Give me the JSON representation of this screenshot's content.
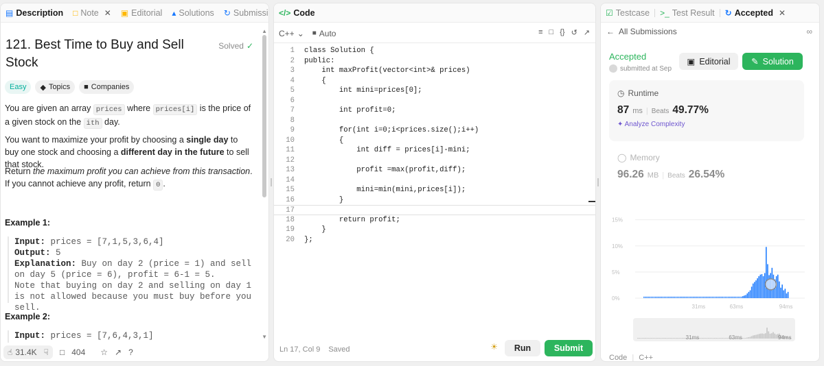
{
  "left": {
    "tabs": [
      {
        "label": "Description",
        "icon": "document-icon"
      },
      {
        "label": "Note",
        "icon": "note-icon"
      },
      {
        "label": "Editorial",
        "icon": "book-icon"
      },
      {
        "label": "Solutions",
        "icon": "flask-icon"
      },
      {
        "label": "Submissio",
        "icon": "history-icon"
      }
    ],
    "title": "121. Best Time to Buy and Sell Stock",
    "solved": "Solved",
    "difficulty": "Easy",
    "topics": "Topics",
    "companies": "Companies",
    "desc": {
      "p1a": "You are given an array ",
      "p1code1": "prices",
      "p1b": " where ",
      "p1code2": "prices[i]",
      "p1c": " is the price of a given stock on the ",
      "p1code3": "ith",
      "p1d": " day.",
      "p2a": "You want to maximize your profit by choosing a ",
      "p2b": "single day",
      "p2c": " to buy one stock and choosing a ",
      "p2d": "different day in the future",
      "p2e": " to sell that stock.",
      "p3a": "Return ",
      "p3b": "the maximum profit you can achieve from this transaction",
      "p3c": ". If you cannot achieve any profit, return ",
      "p3code": "0",
      "p3d": "."
    },
    "example1": {
      "heading": "Example 1:",
      "input_label": "Input:",
      "input": " prices = [7,1,5,3,6,4]",
      "output_label": "Output:",
      "output": " 5",
      "expl_label": "Explanation:",
      "expl": " Buy on day 2 (price = 1) and sell on day 5 (price = 6), profit = 6-1 = 5.\nNote that buying on day 2 and selling on day 1 is not allowed because you must buy before you sell."
    },
    "example2": {
      "heading": "Example 2:",
      "input_label": "Input:",
      "input": " prices = [7,6,4,3,1]"
    },
    "footer": {
      "likes": "31.4K",
      "comments": "404"
    }
  },
  "mid": {
    "tab": "Code",
    "language": "C++",
    "mode": "Auto",
    "code_lines": [
      "class Solution {",
      "public:",
      "    int maxProfit(vector<int>& prices)",
      "    {",
      "        int mini=prices[0];",
      "",
      "        int profit=0;",
      "",
      "        for(int i=0;i<prices.size();i++)",
      "        {",
      "            int diff = prices[i]-mini;",
      "",
      "            profit =max(profit,diff);",
      "",
      "            mini=min(mini,prices[i]);",
      "        }",
      "",
      "        return profit;",
      "    }",
      "};"
    ],
    "status": "Ln 17, Col 9",
    "saved": "Saved",
    "run": "Run",
    "submit": "Submit"
  },
  "right": {
    "tabs": [
      {
        "label": "Testcase",
        "icon": "check-square-icon"
      },
      {
        "label": "Test Result",
        "icon": "terminal-icon"
      },
      {
        "label": "Accepted",
        "icon": "history-icon"
      }
    ],
    "all_submissions": "All Submissions",
    "status": "Accepted",
    "submitted": "submitted at Sep",
    "editorial_btn": "Editorial",
    "solution_btn": "Solution",
    "runtime": {
      "label": "Runtime",
      "value": "87",
      "unit": "ms",
      "beats_label": "Beats",
      "beats": "49.77%",
      "analyze": "Analyze Complexity"
    },
    "memory": {
      "label": "Memory",
      "value": "96.26",
      "unit": "MB",
      "beats_label": "Beats",
      "beats": "26.54%"
    },
    "code_label": "Code",
    "code_lang": "C++"
  },
  "chart_data": {
    "type": "bar",
    "yticks": [
      "15%",
      "10%",
      "5%",
      "0%"
    ],
    "xticks": [
      "31ms",
      "63ms",
      "94ms"
    ],
    "mini_xticks": [
      "31ms",
      "63ms",
      "94ms"
    ],
    "values": [
      0.3,
      0.3,
      0.3,
      0.3,
      0.3,
      0.3,
      0.3,
      0.3,
      0.3,
      0.3,
      0.3,
      0.3,
      0.3,
      0.3,
      0.3,
      0.3,
      0.3,
      0.3,
      0.3,
      0.3,
      0.3,
      0.3,
      0.3,
      0.3,
      0.3,
      0.3,
      0.3,
      0.3,
      0.3,
      0.3,
      0.3,
      0.3,
      0.3,
      0.3,
      0.3,
      0.3,
      0.3,
      0.3,
      0.3,
      0.3,
      0.3,
      0.3,
      0.3,
      0.3,
      0.3,
      0.3,
      0.3,
      0.3,
      0.3,
      0.3,
      0.3,
      0.3,
      0.3,
      0.3,
      0.3,
      0.3,
      0.3,
      0.3,
      0.3,
      0.3,
      0.3,
      0.3,
      0.3,
      0.3,
      0.3,
      0.3,
      0.3,
      0.3,
      0.4,
      0.5,
      0.6,
      0.9,
      1.2,
      1.5,
      2.2,
      2.8,
      3.1,
      3.4,
      3.8,
      4.2,
      4.5,
      4.6,
      4.2,
      4.8,
      9.8,
      6.5,
      4.4,
      4.8,
      5.8,
      4.5,
      3.6,
      4.2,
      4.5,
      3.2,
      2.0,
      2.6,
      1.5,
      1.8,
      0.9,
      1.2
    ],
    "highlight_index": 87,
    "ylim": [
      0,
      16
    ],
    "colors": {
      "bar": "#1677ff",
      "highlight": "#1677ff"
    }
  }
}
